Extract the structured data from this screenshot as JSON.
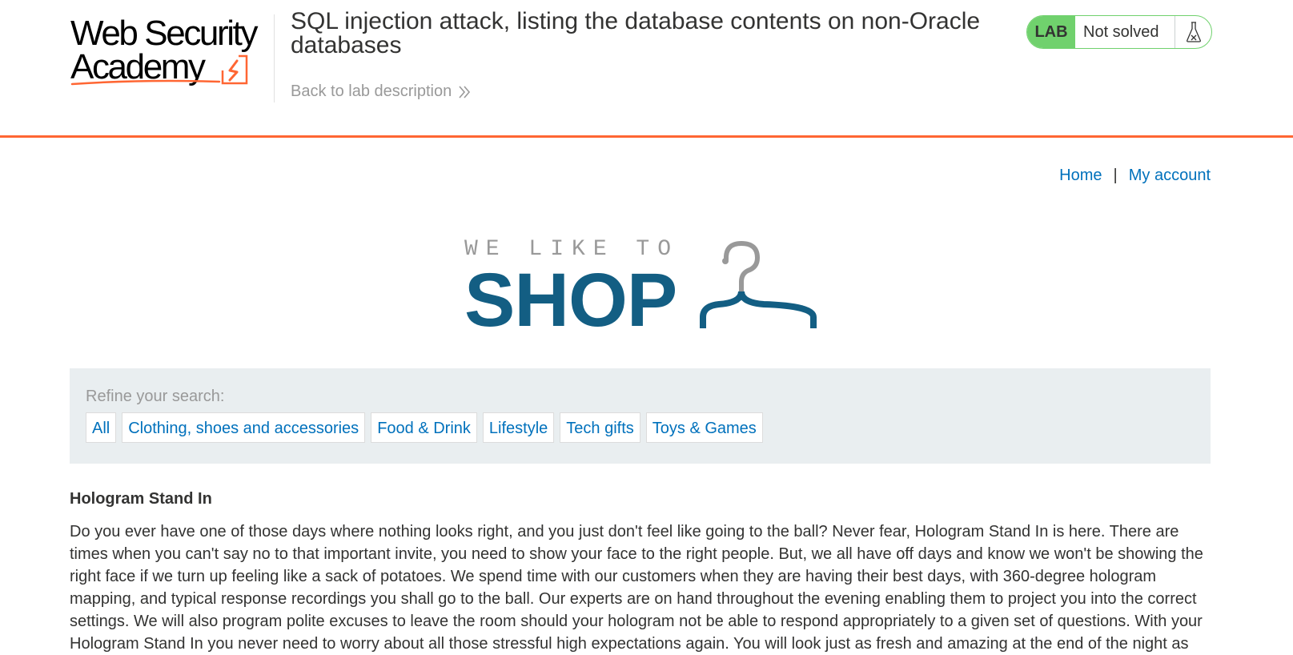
{
  "academy": {
    "logo_line1": "Web Security",
    "logo_line2": "Academy",
    "lab_title": "SQL injection attack, listing the database contents on non-Oracle databases",
    "back_link": "Back to lab description",
    "lab_badge": "LAB",
    "lab_status": "Not solved",
    "icons": [
      "double-chevron-right-icon",
      "flask-icon"
    ],
    "colors": {
      "accent": "#ff6633",
      "solved_green": "#70d16d",
      "link_blue": "#0071bc"
    }
  },
  "nav": {
    "home": "Home",
    "separator": "|",
    "account": "My account"
  },
  "shop_logo": {
    "small": "WE LIKE TO",
    "big": "SHOP",
    "color": "#135e83"
  },
  "filters": {
    "label": "Refine your search:",
    "items": [
      "All",
      "Clothing, shoes and accessories",
      "Food & Drink",
      "Lifestyle",
      "Tech gifts",
      "Toys & Games"
    ]
  },
  "product": {
    "title": "Hologram Stand In",
    "description": "Do you ever have one of those days where nothing looks right, and you just don't feel like going to the ball? Never fear, Hologram Stand In is here. There are times when you can't say no to that important invite, you need to show your face to the right people. But, we all have off days and know we won't be showing the right face if we turn up feeling like a sack of potatoes. We spend time with our customers when they are having their best days, with 360-degree hologram mapping, and typical response recordings you shall go to the ball. Our experts are on hand throughout the evening enabling them to project you into the correct settings. We will also program polite excuses to leave the room should your hologram not be able to respond appropriately to a given set of questions. With your Hologram Stand In you never need to worry about all those stressful high expectations again. You will look just as fresh and amazing at the end of the night as"
  }
}
